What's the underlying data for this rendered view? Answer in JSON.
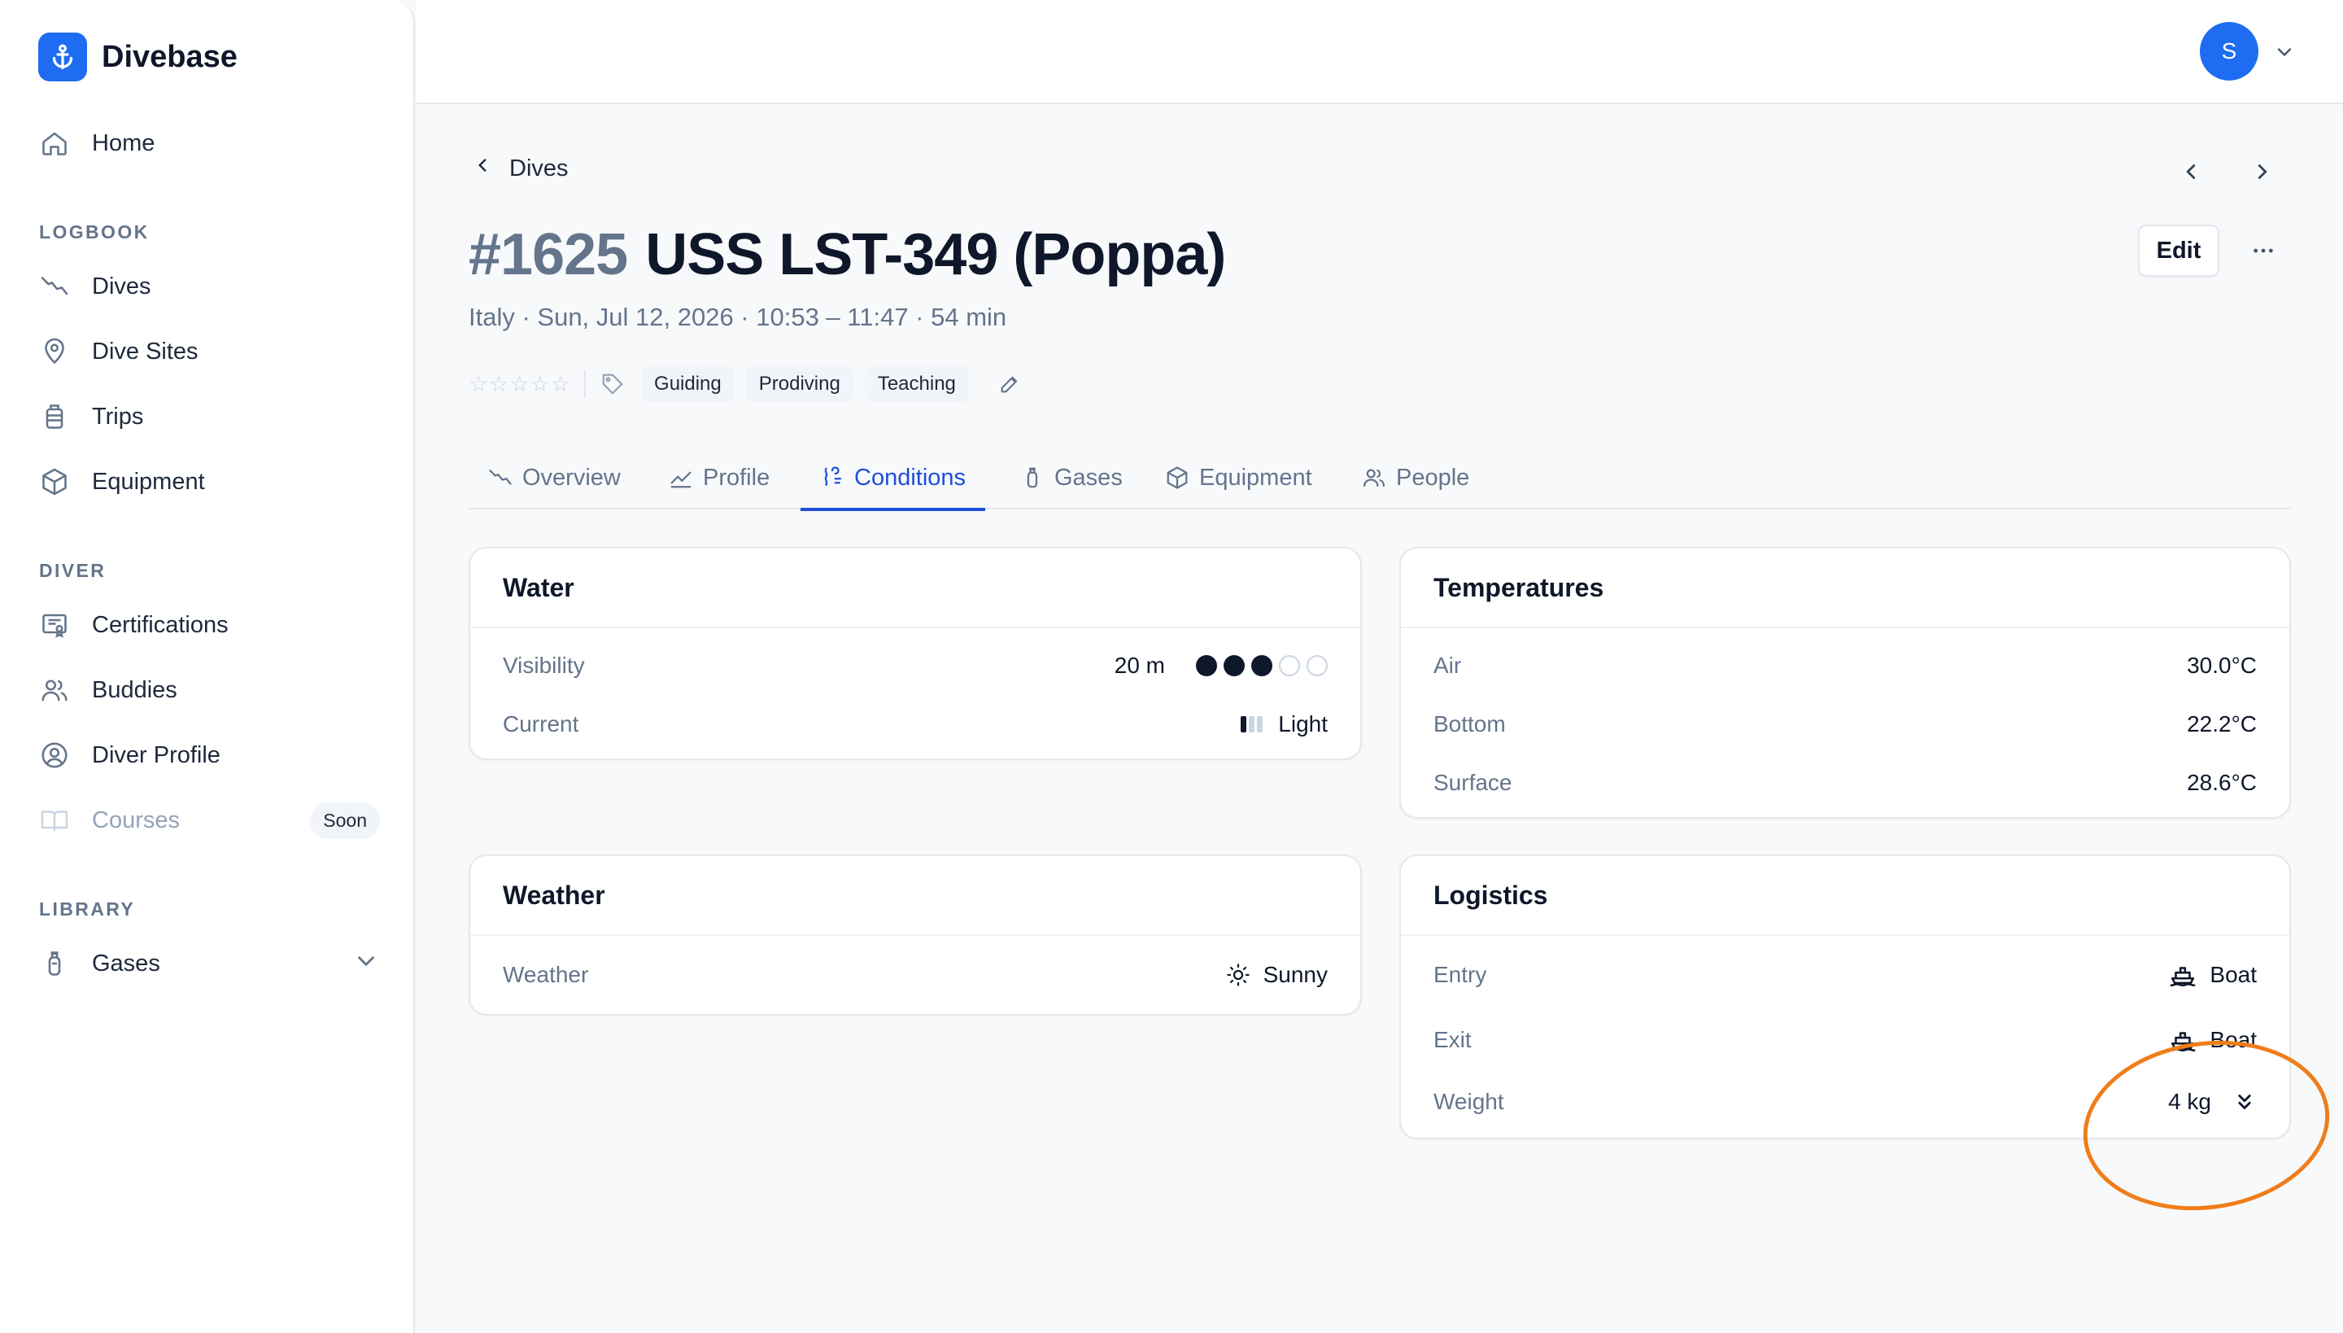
{
  "app": {
    "name": "Divebase"
  },
  "sidebar": {
    "home": "Home",
    "sections": {
      "logbook": "LOGBOOK",
      "diver": "DIVER",
      "library": "LIBRARY"
    },
    "logbook_items": [
      {
        "label": "Dives",
        "icon": "dive-icon"
      },
      {
        "label": "Dive Sites",
        "icon": "map-pin-icon"
      },
      {
        "label": "Trips",
        "icon": "luggage-icon"
      },
      {
        "label": "Equipment",
        "icon": "cube-icon"
      }
    ],
    "diver_items": [
      {
        "label": "Certifications",
        "icon": "certificate-icon"
      },
      {
        "label": "Buddies",
        "icon": "users-icon"
      },
      {
        "label": "Diver Profile",
        "icon": "user-circle-icon"
      },
      {
        "label": "Courses",
        "icon": "book-icon",
        "badge": "Soon"
      }
    ],
    "library_items": [
      {
        "label": "Gases",
        "icon": "tank-icon"
      }
    ]
  },
  "topbar": {
    "avatar_initial": "S"
  },
  "breadcrumb": {
    "back_label": "Dives"
  },
  "dive": {
    "number": "#1625",
    "name": "USS LST-349 (Poppa)",
    "subtitle": "Italy · Sun, Jul 12, 2026 · 10:53 – 11:47 · 54 min",
    "rating": 0,
    "stars": "☆☆☆☆☆",
    "tags": [
      "Guiding",
      "Prodiving",
      "Teaching"
    ]
  },
  "actions": {
    "edit": "Edit"
  },
  "tabs": [
    {
      "label": "Overview",
      "icon": "dive-icon"
    },
    {
      "label": "Profile",
      "icon": "chart-line-icon"
    },
    {
      "label": "Conditions",
      "icon": "waves-icon",
      "active": true
    },
    {
      "label": "Gases",
      "icon": "tank-icon"
    },
    {
      "label": "Equipment",
      "icon": "cube-icon"
    },
    {
      "label": "People",
      "icon": "users-icon"
    }
  ],
  "water": {
    "title": "Water",
    "visibility_label": "Visibility",
    "visibility_value": "20 m",
    "visibility_level": 3,
    "visibility_max": 5,
    "current_label": "Current",
    "current_value": "Light",
    "current_level": 1,
    "current_max": 3
  },
  "temperatures": {
    "title": "Temperatures",
    "rows": [
      {
        "label": "Air",
        "value": "30.0°C"
      },
      {
        "label": "Bottom",
        "value": "22.2°C"
      },
      {
        "label": "Surface",
        "value": "28.6°C"
      }
    ]
  },
  "weather": {
    "title": "Weather",
    "label": "Weather",
    "value": "Sunny",
    "icon": "sun-icon"
  },
  "logistics": {
    "title": "Logistics",
    "entry_label": "Entry",
    "entry_value": "Boat",
    "exit_label": "Exit",
    "exit_value": "Boat",
    "weight_label": "Weight",
    "weight_value": "4 kg",
    "icon": "boat-icon"
  },
  "colors": {
    "brand": "#1d6cf2",
    "active_tab": "#1d4ed8",
    "highlight_ring": "#f07d1a"
  }
}
